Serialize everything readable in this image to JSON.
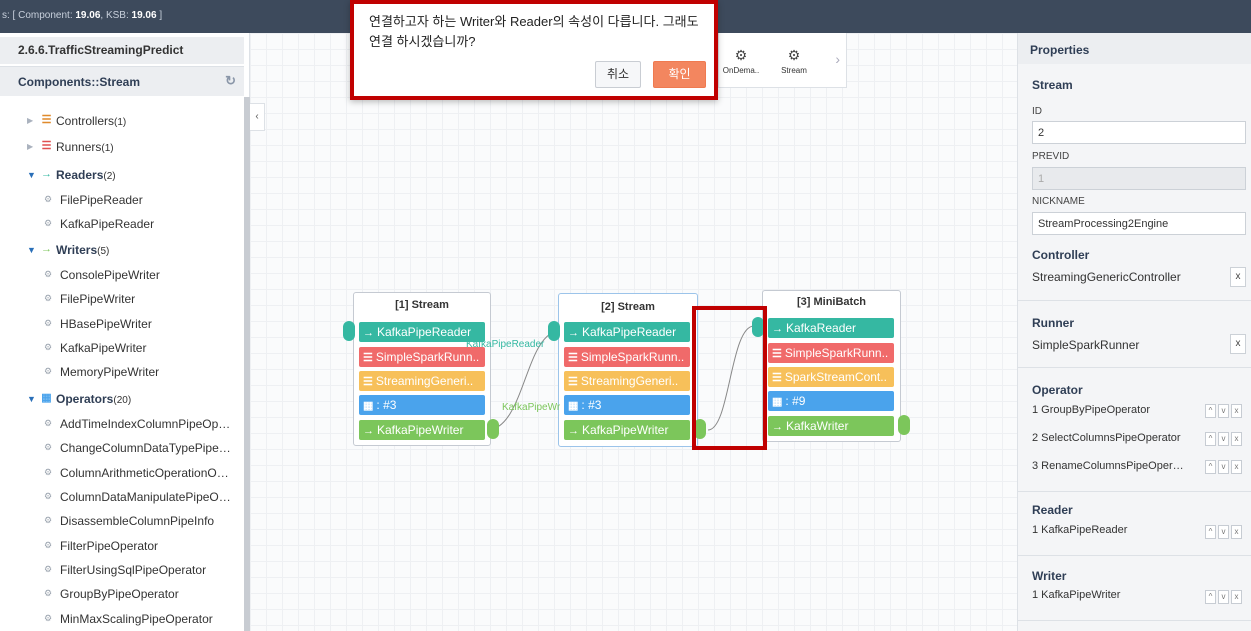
{
  "topbar": {
    "prefix": "s: [ Component: ",
    "component_ver": "19.06",
    "mid": ", KSB: ",
    "ksb_ver": "19.06",
    "suffix": " ]"
  },
  "sidebar": {
    "title": "2.6.6.TrafficStreamingPredict",
    "section": "Components::Stream",
    "groups": [
      {
        "label": "Controllers",
        "count": "(1)"
      },
      {
        "label": "Runners",
        "count": "(1)"
      },
      {
        "label": "Readers",
        "count": "(2)"
      },
      {
        "label": "Writers",
        "count": "(5)"
      },
      {
        "label": "Operators",
        "count": "(20)"
      }
    ],
    "readers": [
      "FilePipeReader",
      "KafkaPipeReader"
    ],
    "writers": [
      "ConsolePipeWriter",
      "FilePipeWriter",
      "HBasePipeWriter",
      "KafkaPipeWriter",
      "MemoryPipeWriter"
    ],
    "operators": [
      "AddTimeIndexColumnPipeOp…",
      "ChangeColumnDataTypePipe…",
      "ColumnArithmeticOperationO…",
      "ColumnDataManipulatePipeO…",
      "DisassembleColumnPipeInfo",
      "FilterPipeOperator",
      "FilterUsingSqlPipeOperator",
      "GroupByPipeOperator",
      "MinMaxScalingPipeOperator"
    ]
  },
  "palette": {
    "items": [
      "OnDema..",
      "Stream"
    ]
  },
  "dialog": {
    "message": "연결하고자 하는 Writer와 Reader의 속성이 다릅니다. 그래도 연결 하시겠습니까?",
    "cancel": "취소",
    "ok": "확인"
  },
  "nodes": [
    {
      "title": "[1] Stream",
      "rows": [
        "KafkaPipeReader",
        "SimpleSparkRunn..",
        "StreamingGeneri..",
        ": #3",
        "KafkaPipeWriter"
      ]
    },
    {
      "title": "[2] Stream",
      "rows": [
        "KafkaPipeReader",
        "SimpleSparkRunn..",
        "StreamingGeneri..",
        ": #3",
        "KafkaPipeWriter"
      ]
    },
    {
      "title": "[3] MiniBatch",
      "rows": [
        "KafkaReader",
        "SimpleSparkRunn..",
        "SparkStreamCont..",
        ": #9",
        "KafkaWriter"
      ]
    }
  ],
  "edge_labels": {
    "reader": "KafkaPipeReader",
    "writer": "KafkaPipeWriter"
  },
  "properties": {
    "header": "Properties",
    "section": "Stream",
    "id_label": "ID",
    "id_value": "2",
    "previd_label": "PREVID",
    "previd_value": "1",
    "nickname_label": "NICKNAME",
    "nickname_value": "StreamProcessing2Engine",
    "controller_label": "Controller",
    "controller_value": "StreamingGenericController",
    "runner_label": "Runner",
    "runner_value": "SimpleSparkRunner",
    "operator_label": "Operator",
    "operators": [
      "1  GroupByPipeOperator",
      "2  SelectColumnsPipeOperator",
      "3  RenameColumnsPipeOper…"
    ],
    "reader_label": "Reader",
    "reader_value": "1  KafkaPipeReader",
    "writer_label": "Writer",
    "writer_value": "1  KafkaPipeWriter",
    "x": "x"
  },
  "colors": {
    "teal": "#35b8a2",
    "red": "#f06a6a",
    "orange": "#f7c05a",
    "blue": "#4aa3ec",
    "green": "#7cc65b",
    "highlight": "#c00000",
    "ok_button": "#f3865f"
  }
}
